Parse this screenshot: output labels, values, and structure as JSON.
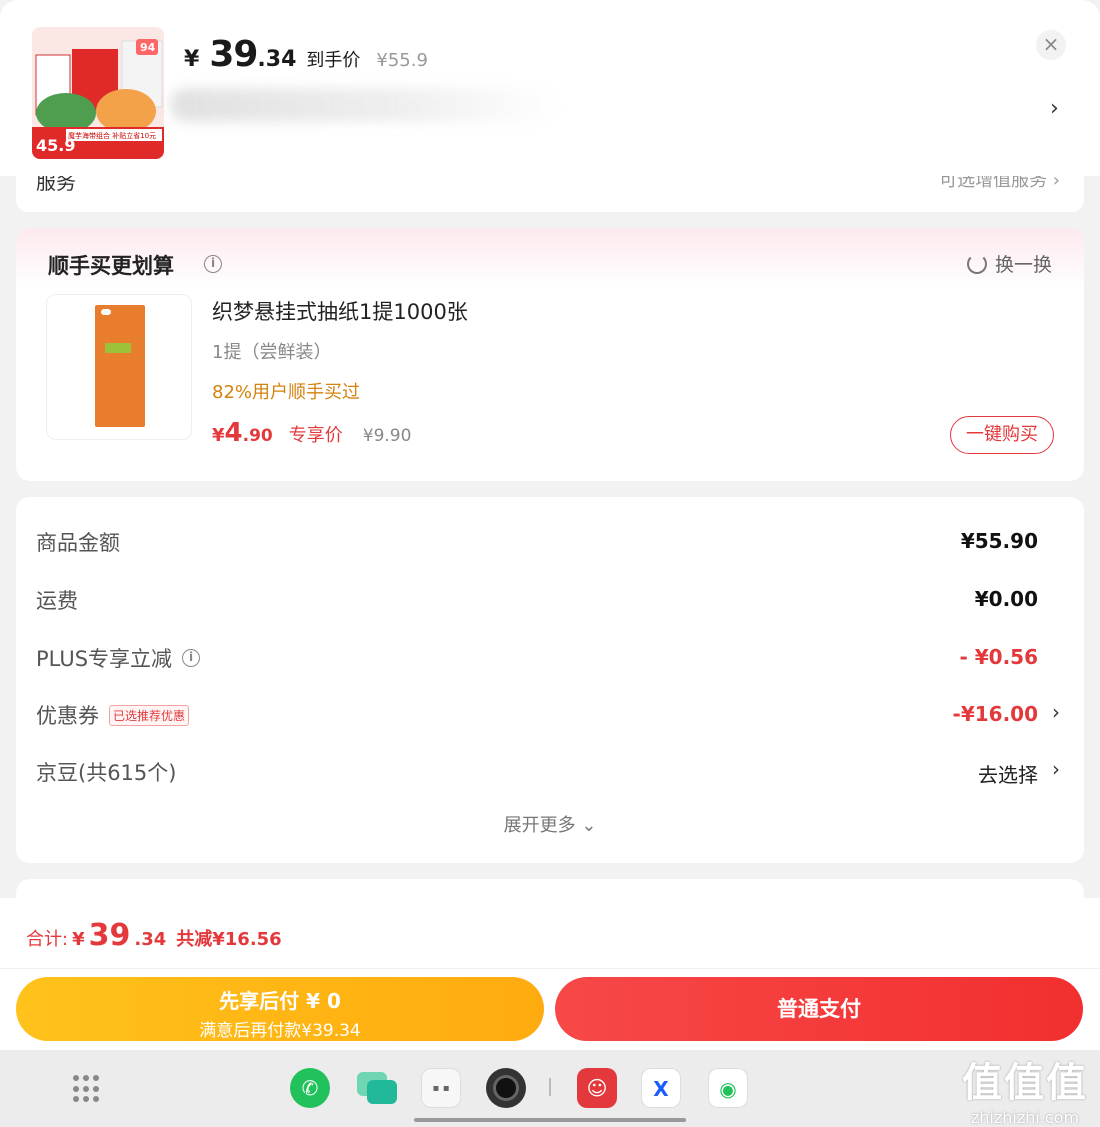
{
  "header": {
    "price_yen": "¥",
    "price_int": "39",
    "price_dec": ".34",
    "price_tag": "到手价",
    "orig_price": "¥55.9",
    "close_glyph": "×",
    "chevron_glyph": "›",
    "thumb_badge": "94",
    "thumb_price": "45.9",
    "thumb_caption": "魔芋海带组合 补贴立省10元"
  },
  "peek": {
    "left": "服务",
    "right": "可选增值服务 ›"
  },
  "upsell": {
    "title": "顺手买更划算",
    "swap_label": "换一换",
    "product_name": "织梦悬挂式抽纸1提1000张",
    "spec": "1提（尝鲜装）",
    "bought": "82%用户顺手买过",
    "price_yen": "¥",
    "price_int": "4",
    "price_dec": ".90",
    "exclusive_label": "专享价",
    "orig_price": "¥9.90",
    "buy_button": "一键购买"
  },
  "summary": {
    "rows": [
      {
        "label": "商品金额",
        "value": "¥55.90"
      },
      {
        "label": "运费",
        "value": "¥0.00"
      },
      {
        "label": "PLUS专享立减",
        "value": "- ¥0.56"
      },
      {
        "label": "优惠券",
        "badge": "已选推荐优惠",
        "value": "-¥16.00"
      },
      {
        "label": "京豆(共615个)",
        "value": "去选择"
      }
    ],
    "expand": "展开更多 ⌄"
  },
  "footer": {
    "total_label": "合计:",
    "total_yen": "¥",
    "total_int": "39",
    "total_dec": ".34",
    "total_save": "共减¥16.56",
    "later_line1": "先享后付 ¥ 0",
    "later_line2": "满意后再付款¥39.34",
    "pay_label": "普通支付"
  },
  "dock": {
    "apps": [
      "phone-icon",
      "messages-icon",
      "folder-icon",
      "camera-icon",
      "jd-icon",
      "x-icon",
      "wechat-icon"
    ]
  },
  "watermark": {
    "logo": "值值值",
    "url": "zhizhizhi.com"
  },
  "colors": {
    "accent_red": "#e4393c",
    "later_yellow": "#ffb414",
    "bought_orange": "#d4820f"
  }
}
